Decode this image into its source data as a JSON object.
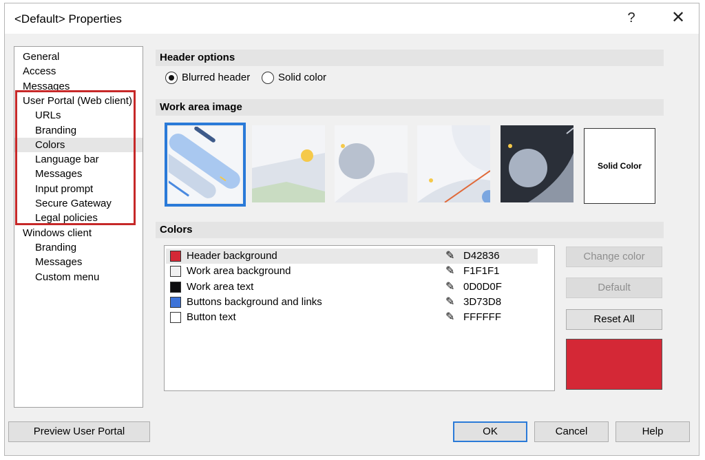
{
  "window": {
    "title": "<Default> Properties",
    "help_glyph": "?",
    "close_glyph": "✕"
  },
  "nav": {
    "items": [
      {
        "label": "General",
        "level": 0
      },
      {
        "label": "Access",
        "level": 0
      },
      {
        "label": "Messages",
        "level": 0
      },
      {
        "label": "User Portal (Web client)",
        "level": 0
      },
      {
        "label": "URLs",
        "level": 1
      },
      {
        "label": "Branding",
        "level": 1
      },
      {
        "label": "Colors",
        "level": 1,
        "selected": true
      },
      {
        "label": "Language bar",
        "level": 1
      },
      {
        "label": "Messages",
        "level": 1
      },
      {
        "label": "Input prompt",
        "level": 1
      },
      {
        "label": "Secure Gateway",
        "level": 1
      },
      {
        "label": "Legal policies",
        "level": 1
      },
      {
        "label": "Windows client",
        "level": 0
      },
      {
        "label": "Branding",
        "level": 1
      },
      {
        "label": "Messages",
        "level": 1
      },
      {
        "label": "Custom menu",
        "level": 1
      }
    ]
  },
  "header_options": {
    "title": "Header options",
    "blurred": {
      "label": "Blurred header",
      "checked": true
    },
    "solid": {
      "label": "Solid color",
      "checked": false
    }
  },
  "work_area": {
    "title": "Work area image",
    "solid_label": "Solid Color"
  },
  "colors": {
    "title": "Colors",
    "items": [
      {
        "name": "Header background",
        "hex": "D42836",
        "swatch": "#d42836",
        "selected": true
      },
      {
        "name": "Work area background",
        "hex": "F1F1F1",
        "swatch": "#f1f1f1"
      },
      {
        "name": "Work area text",
        "hex": "0D0D0F",
        "swatch": "#0d0d0f"
      },
      {
        "name": "Buttons background and links",
        "hex": "3D73D8",
        "swatch": "#3d73d8"
      },
      {
        "name": "Button text",
        "hex": "FFFFFF",
        "swatch": "#ffffff"
      }
    ],
    "change_color": "Change color",
    "default": "Default",
    "reset_all": "Reset All",
    "preview_color": "#d42836"
  },
  "footer": {
    "preview": "Preview User Portal",
    "ok": "OK",
    "cancel": "Cancel",
    "help": "Help"
  },
  "icons": {
    "pencil": "✎"
  }
}
